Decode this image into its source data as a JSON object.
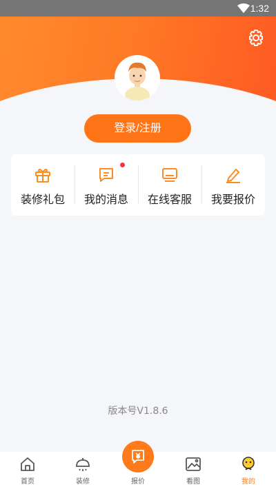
{
  "status_bar": {
    "time": "1:32"
  },
  "header": {
    "login_label": "登录/注册"
  },
  "menu": {
    "items": [
      {
        "label": "装修礼包",
        "icon": "gift-icon"
      },
      {
        "label": "我的消息",
        "icon": "message-icon"
      },
      {
        "label": "在线客服",
        "icon": "monitor-icon"
      },
      {
        "label": "我要报价",
        "icon": "pencil-icon"
      }
    ]
  },
  "footer": {
    "version": "版本号V1.8.6"
  },
  "tabbar": {
    "items": [
      {
        "label": "首页",
        "icon": "home-icon"
      },
      {
        "label": "装修",
        "icon": "bell-icon"
      },
      {
        "label": "报价",
        "icon": "quote-icon"
      },
      {
        "label": "看图",
        "icon": "gallery-icon"
      },
      {
        "label": "我的",
        "icon": "profile-icon",
        "active": true
      }
    ]
  },
  "colors": {
    "accent": "#ff7a1a",
    "badge": "#ef3a3a"
  }
}
